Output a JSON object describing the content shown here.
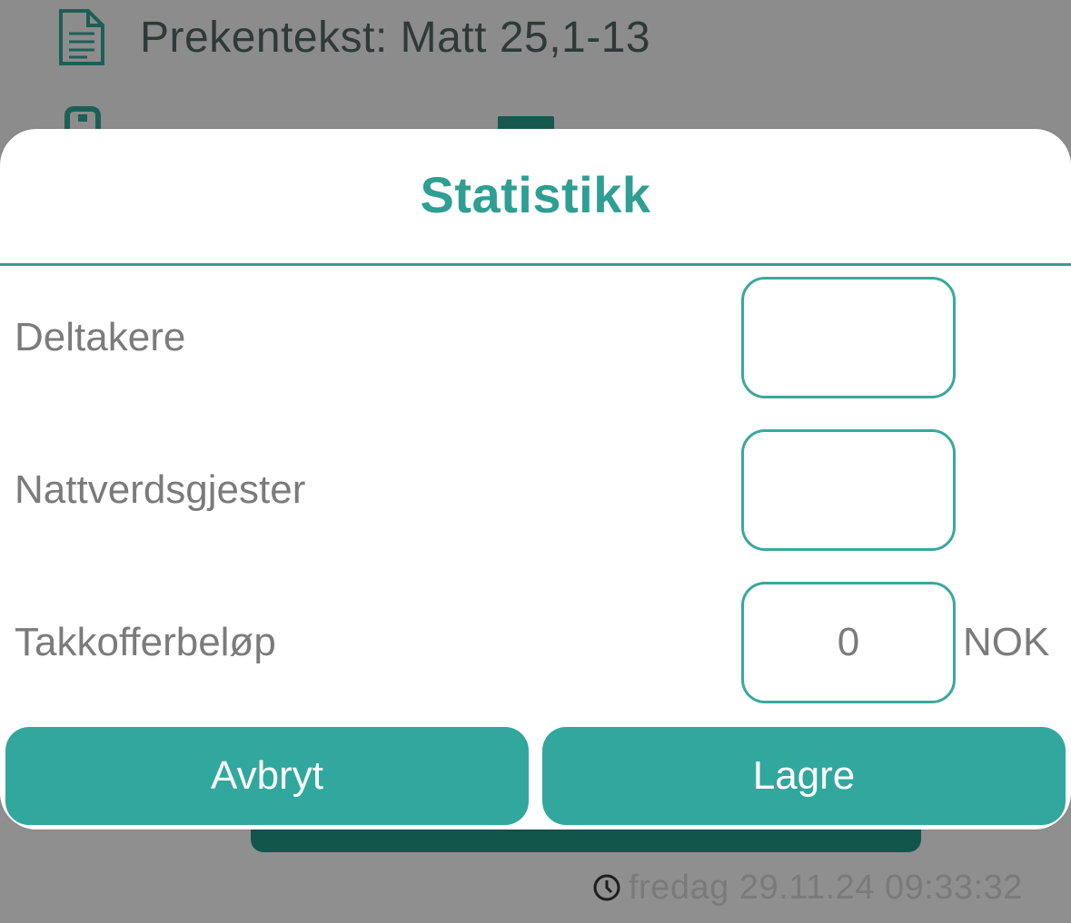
{
  "background": {
    "sermon_text": "Prekentekst: Matt 25,1-13",
    "timestamp": "fredag 29.11.24 09:33:32"
  },
  "dialog": {
    "title": "Statistikk",
    "fields": [
      {
        "label": "Deltakere",
        "value": ""
      },
      {
        "label": "Nattverdsgjester",
        "value": ""
      },
      {
        "label": "Takkofferbeløp",
        "value": "0",
        "unit": "NOK"
      }
    ],
    "cancel_label": "Avbryt",
    "save_label": "Lagre"
  },
  "colors": {
    "accent": "#2f9e93",
    "button": "#32a79d",
    "overlay": "#8c8c8c",
    "dark_button": "#12554b"
  },
  "icons": [
    "document-icon",
    "toolbox-icon",
    "clock-icon"
  ]
}
